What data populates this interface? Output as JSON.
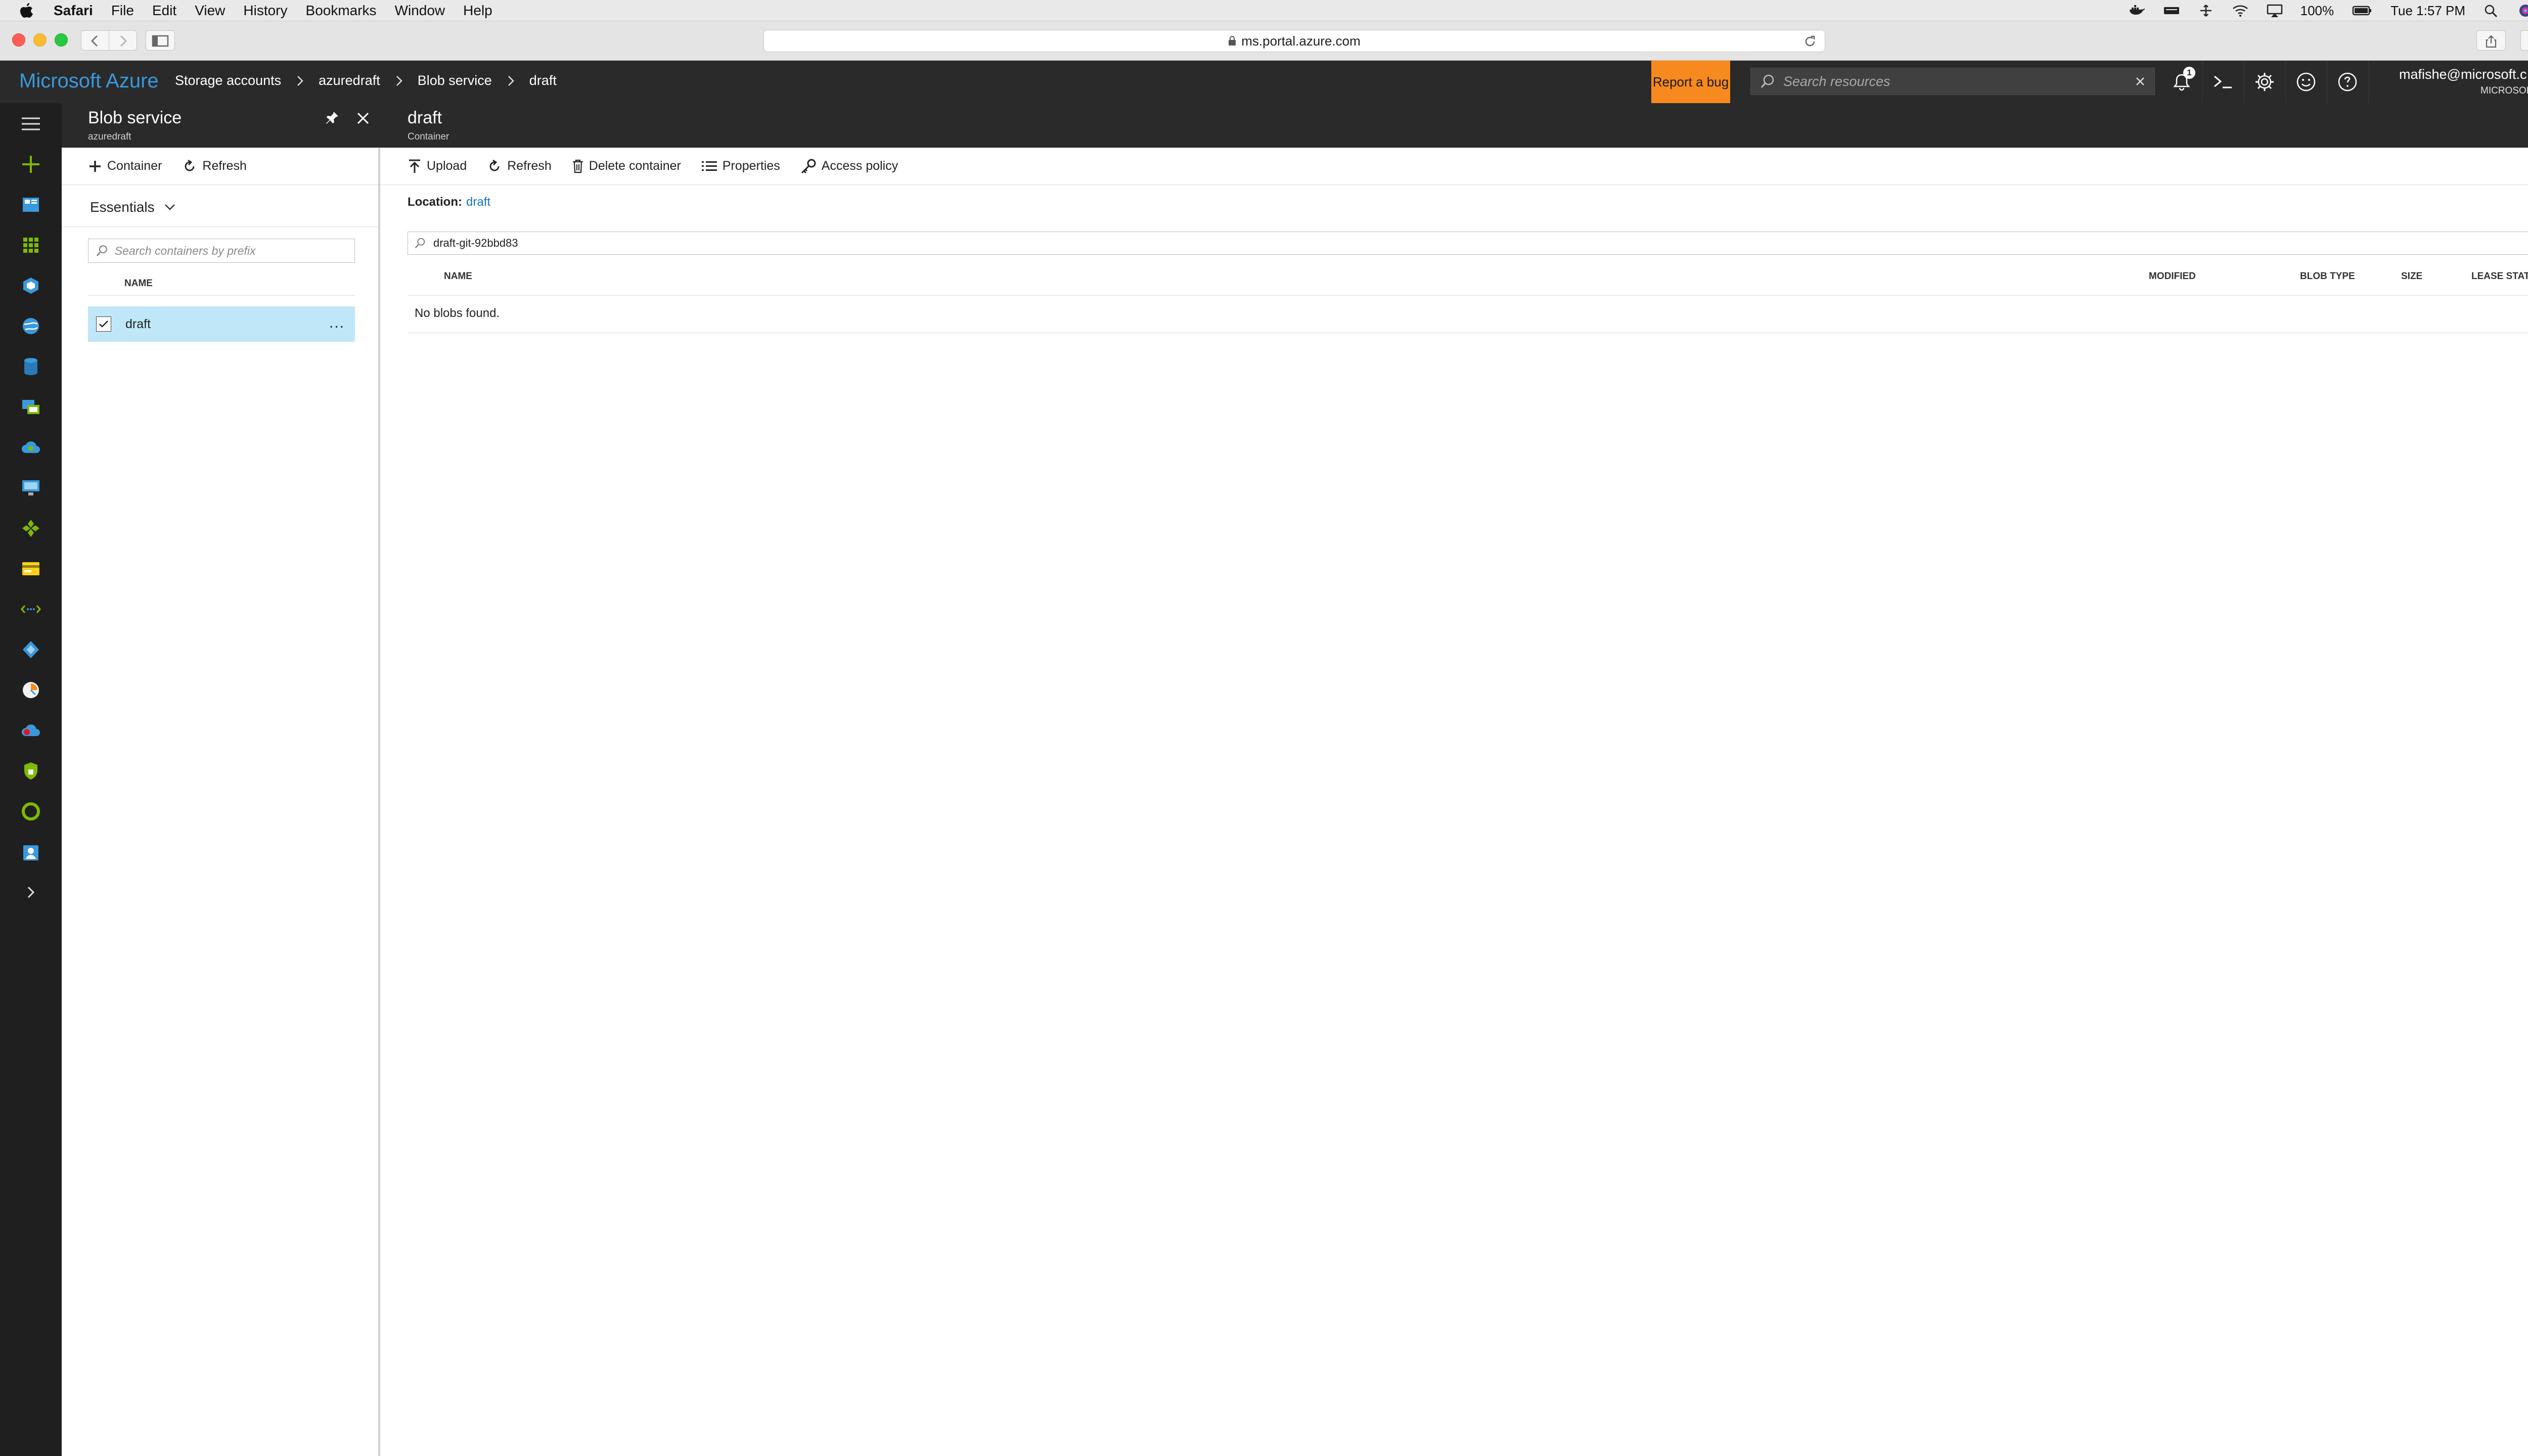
{
  "mac_menu": {
    "app": "Safari",
    "items": [
      "File",
      "Edit",
      "View",
      "History",
      "Bookmarks",
      "Window",
      "Help"
    ],
    "battery": "100%",
    "clock": "Tue 1:57 PM"
  },
  "browser": {
    "url": "ms.portal.azure.com"
  },
  "azure": {
    "brand": "Microsoft Azure",
    "breadcrumb": [
      "Storage accounts",
      "azuredraft",
      "Blob service",
      "draft"
    ],
    "report_bug": "Report a bug",
    "search_placeholder": "Search resources",
    "notification_count": "1",
    "account_email": "mafishe@microsoft.c...",
    "account_org": "MICROSOFT",
    "accent_color": "#3999dc",
    "report_bug_color": "#f78a1e"
  },
  "left_rail": {
    "icons": [
      "hamburger-icon",
      "plus-icon",
      "dashboard-icon",
      "all-resources-icon",
      "resource-groups-icon",
      "app-services-icon",
      "sql-databases-icon",
      "virtual-machines-icon",
      "cloud-services-icon",
      "monitor-icon",
      "extensions-icon",
      "subscriptions-icon",
      "virtual-networks-icon",
      "azure-ad-icon",
      "advisor-icon",
      "cloud-icon",
      "security-icon",
      "o-circle-icon",
      "user-icon",
      "chevron-right-icon"
    ]
  },
  "blob_blade": {
    "title": "Blob service",
    "subtitle": "azuredraft",
    "commands": {
      "container": "Container",
      "refresh": "Refresh"
    },
    "essentials": "Essentials",
    "search_placeholder": "Search containers by prefix",
    "column_name": "NAME",
    "containers": [
      {
        "name": "draft",
        "selected": true,
        "more": "..."
      }
    ],
    "selected_row_color": "#bfe7f7"
  },
  "draft_blade": {
    "title": "draft",
    "subtitle": "Container",
    "commands": {
      "upload": "Upload",
      "refresh": "Refresh",
      "delete": "Delete container",
      "properties": "Properties",
      "access_policy": "Access policy"
    },
    "location_label": "Location:",
    "location_value": "draft",
    "search_value": "draft-git-92bbd83",
    "columns": [
      "NAME",
      "MODIFIED",
      "BLOB TYPE",
      "SIZE",
      "LEASE STATE"
    ],
    "empty_message": "No blobs found."
  }
}
